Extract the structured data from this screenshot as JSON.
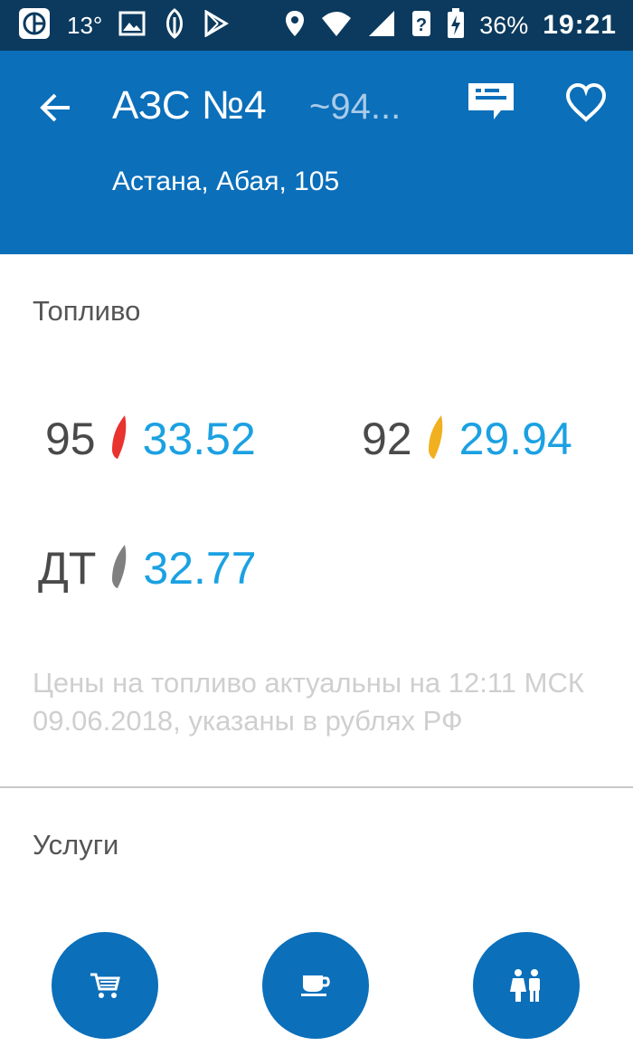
{
  "status_bar": {
    "temperature": "13°",
    "battery_percent": "36%",
    "time": "19:21",
    "icons": [
      "app-icon",
      "image-icon",
      "leaf-icon",
      "play-store-icon",
      "location-icon",
      "wifi-icon",
      "signal-icon",
      "sim-icon",
      "battery-charging-icon"
    ]
  },
  "header": {
    "title": "АЗС №4",
    "distance": "~94...",
    "address": "Астана, Абая, 105",
    "background_color": "#0b6fba"
  },
  "fuel": {
    "section_title": "Топливо",
    "items": [
      {
        "name": "95",
        "price": "33.52",
        "color": "#e8332f"
      },
      {
        "name": "92",
        "price": "29.94",
        "color": "#f0b020"
      },
      {
        "name": "ДТ",
        "price": "32.77",
        "color": "#808080"
      }
    ],
    "note": "Цены на топливо актуальны на 12:11 МСК 09.06.2018, указаны в рублях РФ"
  },
  "services": {
    "section_title": "Услуги",
    "items": [
      {
        "icon": "cart-icon"
      },
      {
        "icon": "coffee-cup-icon"
      },
      {
        "icon": "restroom-icon"
      }
    ]
  }
}
